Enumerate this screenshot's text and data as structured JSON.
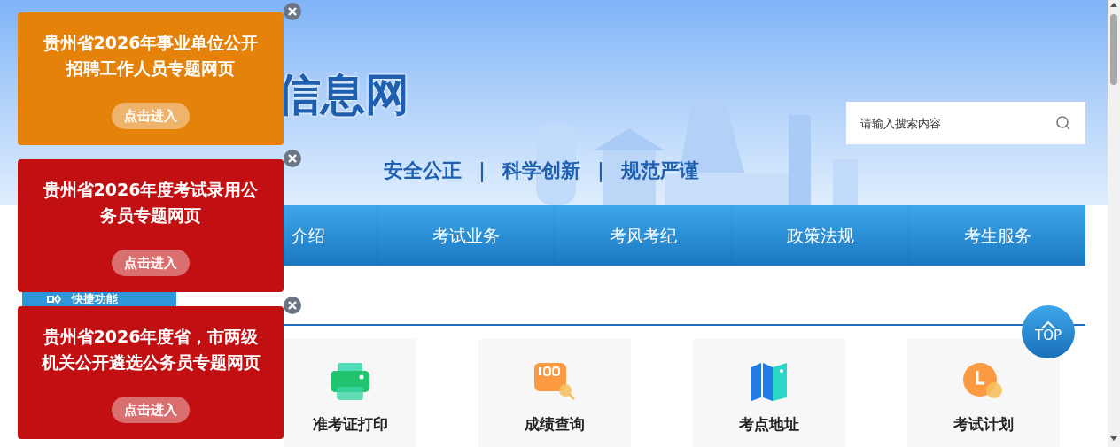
{
  "header": {
    "logo_text": "信息网",
    "slogan": [
      "安全公正",
      "｜",
      "科学创新",
      "｜",
      "规范严谨"
    ],
    "search": {
      "placeholder": "请输入搜索内容"
    }
  },
  "nav": {
    "items": [
      {
        "label": "介绍"
      },
      {
        "label": "考试业务"
      },
      {
        "label": "考风考纪"
      },
      {
        "label": "政策法规"
      },
      {
        "label": "考生服务"
      }
    ]
  },
  "quick_section": {
    "title": "快捷功能"
  },
  "shortcuts": [
    {
      "label": "准考证打印",
      "kind": "printer"
    },
    {
      "label": "成绩查询",
      "kind": "score"
    },
    {
      "label": "考点地址",
      "kind": "map"
    },
    {
      "label": "考试计划",
      "kind": "clock"
    }
  ],
  "popups": [
    {
      "title": "贵州省2026年事业单位公开招聘工作人员专题网页",
      "button": "点击进入",
      "color": "#e5820a"
    },
    {
      "title": "贵州省2026年度考试录用公务员专题网页",
      "button": "点击进入",
      "color": "#c20f12"
    },
    {
      "title": "贵州省2026年度省，市两级机关公开遴选公务员专题网页",
      "button": "点击进入",
      "color": "#c20f12"
    }
  ],
  "top_button": {
    "label": "TOP"
  }
}
